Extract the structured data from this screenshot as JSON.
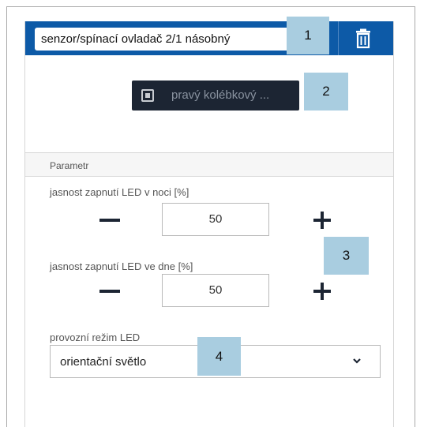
{
  "header": {
    "device_name": "senzor/spínací ovladač 2/1 násobný",
    "delete_icon": "trash-icon"
  },
  "channel": {
    "button_label": "pravý kolébkový ...",
    "button_icon": "rocker-switch-icon"
  },
  "parameters": {
    "section_title": "Parametr",
    "night_led": {
      "label": "jasnost zapnutí LED v noci [%]",
      "value": "50"
    },
    "day_led": {
      "label": "jasnost zapnutí LED ve dne [%]",
      "value": "50"
    },
    "led_mode": {
      "label": "provozní režim LED",
      "selected": "orientační světlo"
    }
  },
  "callouts": [
    "1",
    "2",
    "3",
    "4"
  ],
  "colors": {
    "header_bg": "#0d5aa7",
    "button_bg": "#1c2533",
    "callout_bg": "#a9cde0"
  }
}
